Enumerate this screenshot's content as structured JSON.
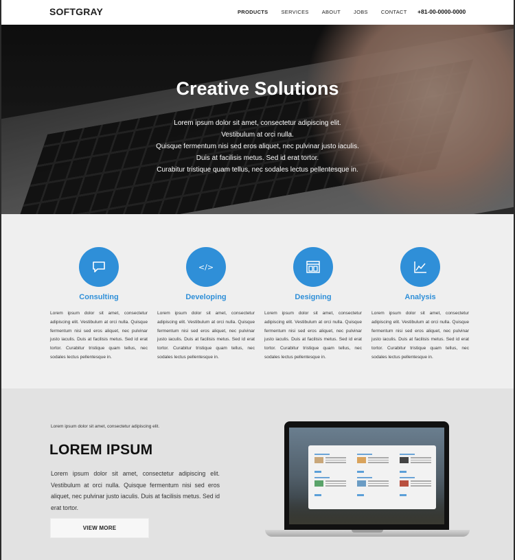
{
  "nav": {
    "logo": "SOFTGRAY",
    "items": [
      {
        "label": "PRODUCTS",
        "active": true
      },
      {
        "label": "SERVICES",
        "active": false
      },
      {
        "label": "ABOUT",
        "active": false
      },
      {
        "label": "JOBS",
        "active": false
      },
      {
        "label": "CONTACT",
        "active": false
      }
    ],
    "phone": "+81-00-0000-0000"
  },
  "hero": {
    "title": "Creative Solutions",
    "lines": [
      "Lorem ipsum dolor sit amet, consectetur adipiscing elit.",
      "Vestibulum at orci nulla.",
      "Quisque fermentum nisi sed eros aliquet, nec pulvinar justo iaculis.",
      "Duis at facilisis metus. Sed id erat tortor.",
      "Curabitur tristique quam tellus, nec sodales lectus pellentesque in."
    ]
  },
  "services": [
    {
      "title": "Consulting",
      "icon": "chat-bubble-icon",
      "text": "Lorem ipsum dolor sit amet, consectetur adipiscing elit. Vestibulum at orci nulla. Quisque fermentum nisi sed eros aliquet, nec pulvinar justo iaculis. Duis at facilisis metus. Sed id erat tortor. Curabitur tristique quam tellus, nec sodales lectus pellentesque in."
    },
    {
      "title": "Developing",
      "icon": "code-icon",
      "text": "Lorem ipsum dolor sit amet, consectetur adipiscing elit. Vestibulum at orci nulla. Quisque fermentum nisi sed eros aliquet, nec pulvinar justo iaculis. Duis at facilisis metus. Sed id erat tortor. Curabitur tristique quam tellus, nec sodales lectus pellentesque in."
    },
    {
      "title": "Designing",
      "icon": "layout-icon",
      "text": "Lorem ipsum dolor sit amet, consectetur adipiscing elit. Vestibulum at orci nulla. Quisque fermentum nisi sed eros aliquet, nec pulvinar justo iaculis. Duis at facilisis metus. Sed id erat tortor. Curabitur tristique quam tellus, nec sodales lectus pellentesque in."
    },
    {
      "title": "Analysis",
      "icon": "line-chart-icon",
      "text": "Lorem ipsum dolor sit amet, consectetur adipiscing elit. Vestibulum at orci nulla. Quisque fermentum nisi sed eros aliquet, nec pulvinar justo iaculis. Duis at facilisis metus. Sed id erat tortor. Curabitur tristique quam tellus, nec sodales lectus pellentesque in."
    }
  ],
  "feature": {
    "caption": "Lorem ipsum dolor sit amet, consectetur adipiscing elit.",
    "title": "LOREM IPSUM",
    "body": "Lorem ipsum dolor sit amet, consectetur adipiscing elit. Vestibulum at orci nulla. Quisque fermentum nisi sed eros aliquet, nec pulvinar justo iaculis. Duis at facilisis metus. Sed id erat tortor.",
    "button": "VIEW MORE"
  },
  "colors": {
    "accent": "#2f8fd8",
    "nav_bg": "#ffffff",
    "services_bg": "#efefef",
    "feature_bg": "#e2e2e2"
  }
}
